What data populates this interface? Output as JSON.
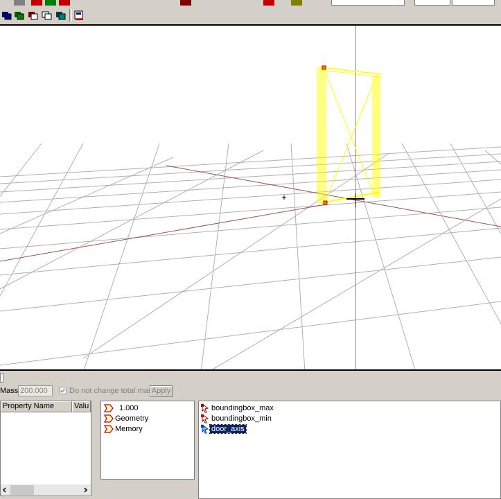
{
  "status": {
    "field": ""
  },
  "mass_row": {
    "mass_label": "Mass:",
    "mass_value": "200.000",
    "keep_mass_label": "Do not change total mass",
    "keep_mass_checked": true,
    "apply_label": "Apply"
  },
  "property_grid": {
    "col_name": "Property Name",
    "col_value": "Valu"
  },
  "tree": {
    "items": [
      {
        "label": "1.000"
      },
      {
        "label": "Geometry"
      },
      {
        "label": "Memory"
      }
    ]
  },
  "list": {
    "items": [
      {
        "label": "boundingbox_max"
      },
      {
        "label": "boundingbox_min"
      },
      {
        "label": "door_axis"
      }
    ]
  },
  "colors": {
    "selection": "#0a246a",
    "highlight": "#ffff00",
    "grid": "#b0b0b0",
    "axis_red": "#a05050",
    "window_face": "#d4d0c8"
  }
}
